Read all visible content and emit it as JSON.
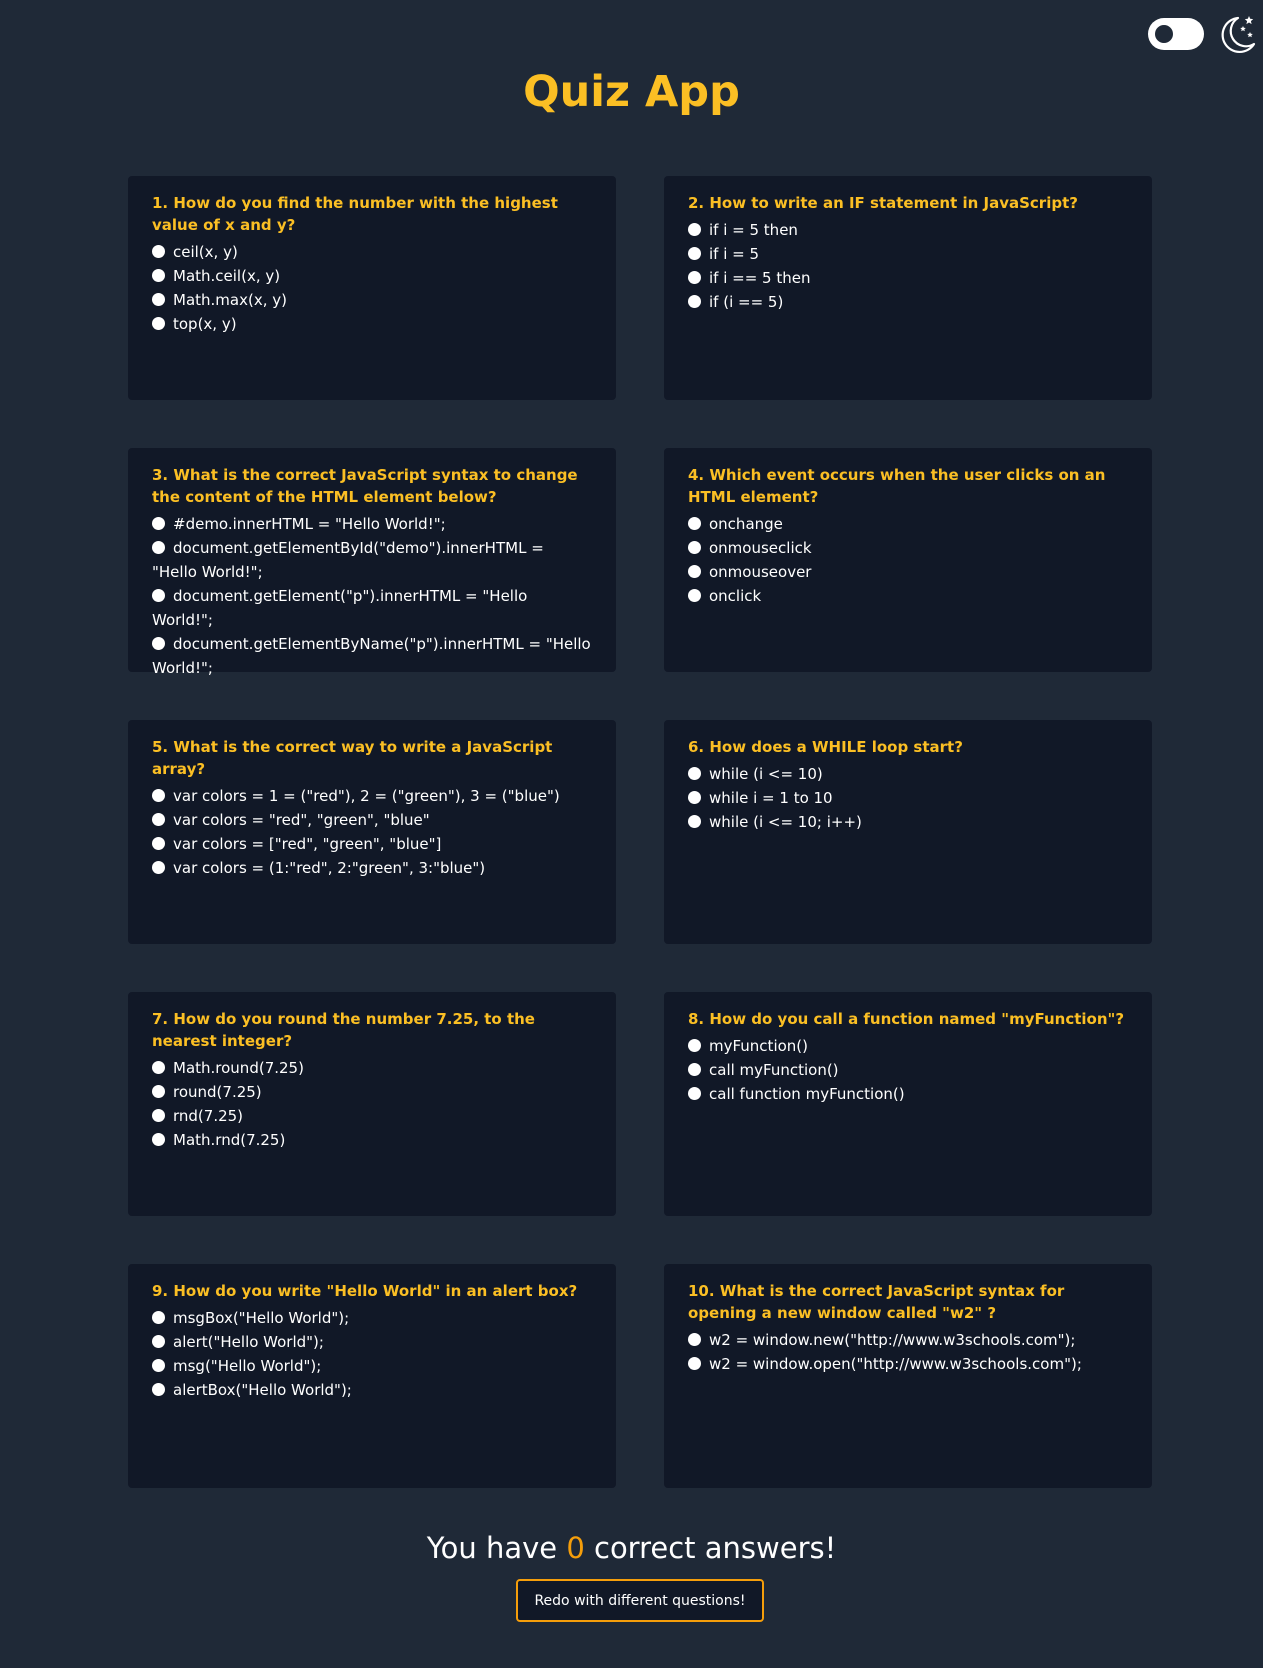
{
  "app": {
    "title": "Quiz App"
  },
  "colors": {
    "accent": "#fbbf24",
    "score_accent": "#f59e0b",
    "background": "#1f2937",
    "card": "#111827"
  },
  "header": {
    "toggle_icon": "toggle-switch-icon",
    "theme_icon": "moon-stars-icon"
  },
  "questions": [
    {
      "title": "1. How do you find the number with the highest value of x and y?",
      "options": [
        "ceil(x, y)",
        "Math.ceil(x, y)",
        "Math.max(x, y)",
        "top(x, y)"
      ]
    },
    {
      "title": "2. How to write an IF statement in JavaScript?",
      "options": [
        "if i = 5 then",
        "if i = 5",
        "if i == 5 then",
        "if (i == 5)"
      ]
    },
    {
      "title": "3. What is the correct JavaScript syntax to change the content of the HTML element below?",
      "options": [
        "#demo.innerHTML = \"Hello World!\";",
        "document.getElementById(\"demo\").innerHTML = \"Hello World!\";",
        "document.getElement(\"p\").innerHTML = \"Hello World!\";",
        "document.getElementByName(\"p\").innerHTML = \"Hello World!\";"
      ]
    },
    {
      "title": "4. Which event occurs when the user clicks on an HTML element?",
      "options": [
        "onchange",
        "onmouseclick",
        "onmouseover",
        "onclick"
      ]
    },
    {
      "title": "5. What is the correct way to write a JavaScript array?",
      "options": [
        "var colors = 1 = (\"red\"), 2 = (\"green\"), 3 = (\"blue\")",
        "var colors = \"red\", \"green\", \"blue\"",
        "var colors = [\"red\", \"green\", \"blue\"]",
        "var colors = (1:\"red\", 2:\"green\", 3:\"blue\")"
      ]
    },
    {
      "title": "6. How does a WHILE loop start?",
      "options": [
        "while (i <= 10)",
        "while i = 1 to 10",
        "while (i <= 10; i++)"
      ]
    },
    {
      "title": "7. How do you round the number 7.25, to the nearest integer?",
      "options": [
        "Math.round(7.25)",
        "round(7.25)",
        "rnd(7.25)",
        "Math.rnd(7.25)"
      ]
    },
    {
      "title": "8. How do you call a function named \"myFunction\"?",
      "options": [
        "myFunction()",
        "call myFunction()",
        "call function myFunction()"
      ]
    },
    {
      "title": "9. How do you write \"Hello World\" in an alert box?",
      "options": [
        "msgBox(\"Hello World\");",
        "alert(\"Hello World\");",
        "msg(\"Hello World\");",
        "alertBox(\"Hello World\");"
      ]
    },
    {
      "title": "10. What is the correct JavaScript syntax for opening a new window called \"w2\" ?",
      "options": [
        "w2 = window.new(\"http://www.w3schools.com\");",
        "w2 = window.open(\"http://www.w3schools.com\");"
      ]
    }
  ],
  "result": {
    "prefix": "You have",
    "count": "0",
    "suffix": "correct answers!",
    "redo_label": "Redo with different questions!"
  }
}
